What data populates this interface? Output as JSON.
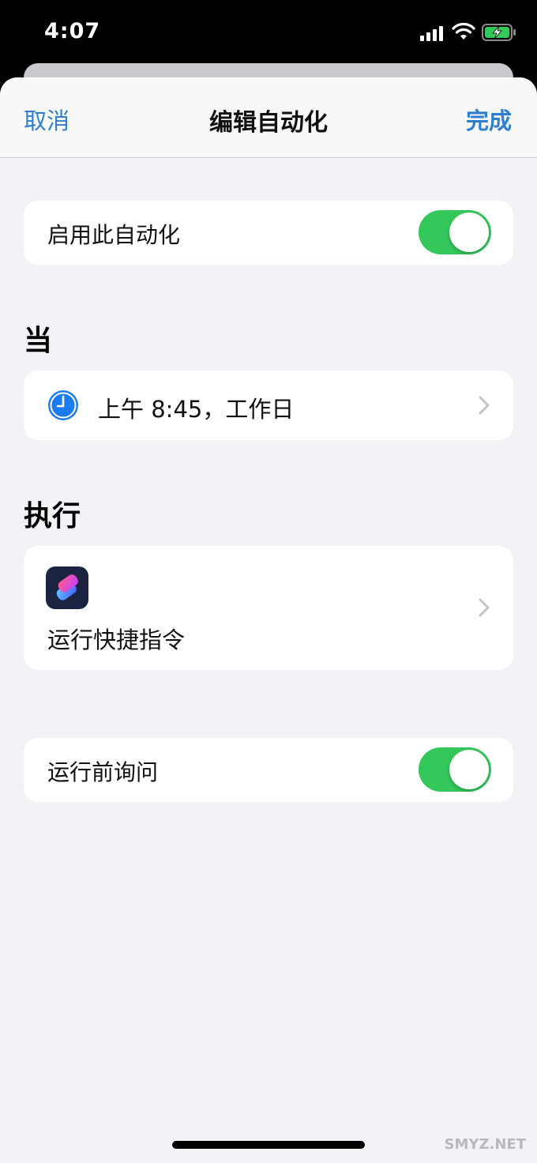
{
  "status_bar": {
    "time": "4:07",
    "icons": [
      "signal-icon",
      "wifi-icon",
      "battery-charging-icon"
    ]
  },
  "nav": {
    "cancel_label": "取消",
    "title": "编辑自动化",
    "done_label": "完成"
  },
  "enable_row": {
    "label": "启用此自动化",
    "toggle_on": true
  },
  "when_section": {
    "header": "当",
    "trigger": {
      "icon": "clock-icon",
      "label": "上午 8:45，工作日"
    }
  },
  "do_section": {
    "header": "执行",
    "action": {
      "icon": "shortcuts-app-icon",
      "label": "运行快捷指令"
    }
  },
  "ask_row": {
    "label": "运行前询问",
    "toggle_on": true
  },
  "watermark": "SMYZ.NET",
  "colors": {
    "accent": "#2f7fd0",
    "toggle_on": "#34c759",
    "background": "#f2f2f7",
    "clock": "#1a7cf0"
  }
}
